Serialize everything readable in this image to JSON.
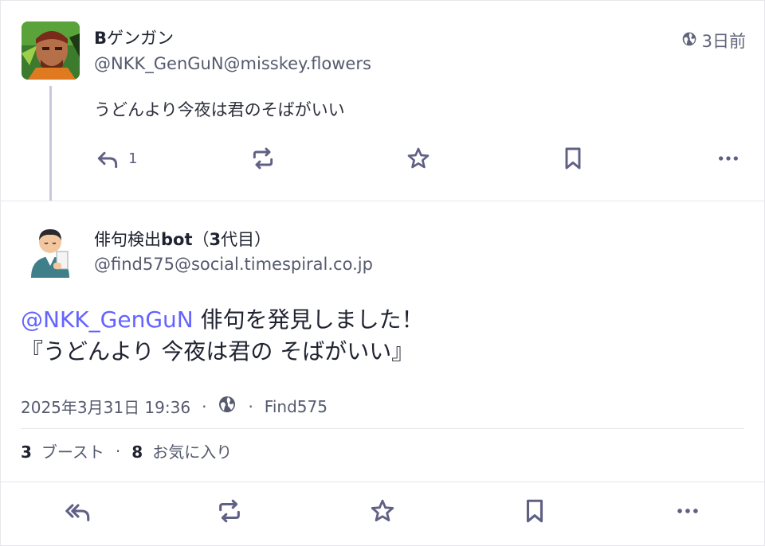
{
  "reply_post": {
    "display_name_bold": "B",
    "display_name_rest": "ゲンガン",
    "handle": "@NKK_GenGuN@misskey.flowers",
    "time": "3日前",
    "text": "うどんより今夜は君のそばがいい",
    "reply_count": "1"
  },
  "main_post": {
    "display_name_pre": "俳句検出",
    "display_name_bold1": "bot",
    "display_name_mid": "（",
    "display_name_bold2": "3",
    "display_name_post": "代目）",
    "handle": "@find575@social.timespiral.co.jp",
    "mention": "@NKK_GenGuN",
    "line1_rest": " 俳句を発見しました！",
    "line2": "『うどんより 今夜は君の そばがいい』",
    "timestamp": "2025年3月31日 19:36",
    "dot": "·",
    "app": "Find575",
    "boost_count": "3",
    "boost_label": "ブースト",
    "fav_count": "8",
    "fav_label": "お気に入り"
  },
  "colors": {
    "accent": "#6364ff",
    "icon": "#606085",
    "thread_line": "#c9c6e0"
  }
}
